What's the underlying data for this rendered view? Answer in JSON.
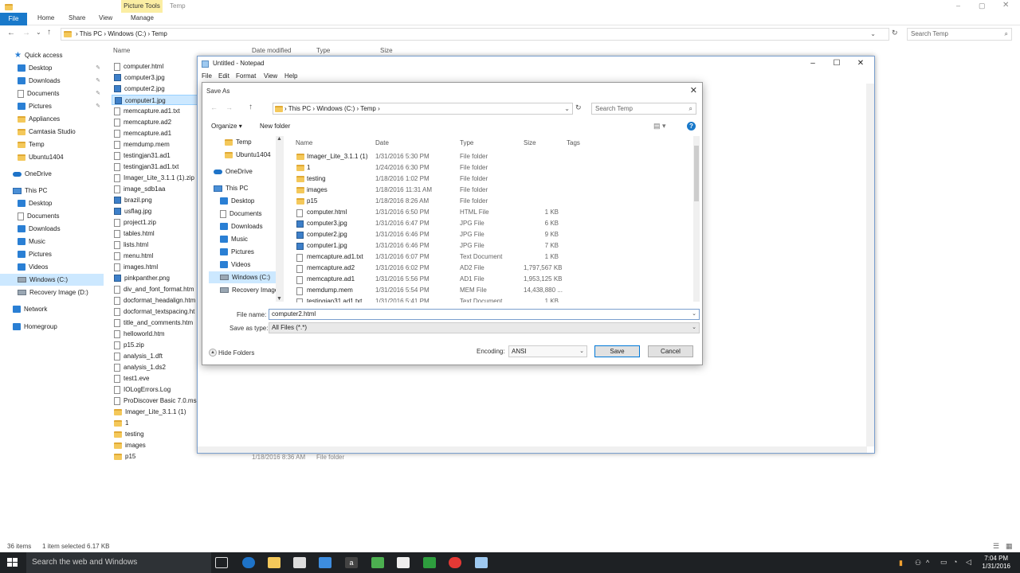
{
  "explorer": {
    "context_tab": "Picture Tools",
    "window_title": "Temp",
    "tabs": [
      "File",
      "Home",
      "Share",
      "View",
      "Manage"
    ],
    "breadcrumb": [
      "This PC",
      "Windows (C:)",
      "Temp"
    ],
    "search_placeholder": "Search Temp",
    "columns": [
      "Name",
      "Date modified",
      "Type",
      "Size"
    ],
    "nav": [
      {
        "label": "Quick access",
        "icon": "star-icon"
      },
      {
        "label": "Desktop",
        "icon": "desktop-icon",
        "pinned": true
      },
      {
        "label": "Downloads",
        "icon": "downloads-icon",
        "pinned": true
      },
      {
        "label": "Documents",
        "icon": "documents-icon",
        "pinned": true
      },
      {
        "label": "Pictures",
        "icon": "pictures-icon",
        "pinned": true
      },
      {
        "label": "Appliances",
        "icon": "folder-icon"
      },
      {
        "label": "Camtasia Studio",
        "icon": "folder-icon"
      },
      {
        "label": "Temp",
        "icon": "folder-icon"
      },
      {
        "label": "Ubuntu1404",
        "icon": "folder-icon"
      },
      {
        "label": "OneDrive",
        "icon": "onedrive-icon"
      },
      {
        "label": "This PC",
        "icon": "pc-icon"
      },
      {
        "label": "Desktop",
        "icon": "desktop-icon"
      },
      {
        "label": "Documents",
        "icon": "documents-icon"
      },
      {
        "label": "Downloads",
        "icon": "downloads-icon"
      },
      {
        "label": "Music",
        "icon": "music-icon"
      },
      {
        "label": "Pictures",
        "icon": "pictures-icon"
      },
      {
        "label": "Videos",
        "icon": "videos-icon"
      },
      {
        "label": "Windows (C:)",
        "icon": "drive-icon",
        "selected": true
      },
      {
        "label": "Recovery Image (D:)",
        "icon": "drive-icon"
      },
      {
        "label": "Network",
        "icon": "network-icon"
      },
      {
        "label": "Homegroup",
        "icon": "homegroup-icon"
      }
    ],
    "files": [
      {
        "name": "computer.html",
        "icon": "file"
      },
      {
        "name": "computer3.jpg",
        "icon": "img"
      },
      {
        "name": "computer2.jpg",
        "icon": "img"
      },
      {
        "name": "computer1.jpg",
        "icon": "img",
        "selected": true
      },
      {
        "name": "memcapture.ad1.txt",
        "icon": "file"
      },
      {
        "name": "memcapture.ad2",
        "icon": "file"
      },
      {
        "name": "memcapture.ad1",
        "icon": "file"
      },
      {
        "name": "memdump.mem",
        "icon": "file"
      },
      {
        "name": "testingjan31.ad1",
        "icon": "file"
      },
      {
        "name": "testingjan31.ad1.txt",
        "icon": "file"
      },
      {
        "name": "Imager_Lite_3.1.1 (1).zip",
        "icon": "file"
      },
      {
        "name": "image_sdb1aa",
        "icon": "file"
      },
      {
        "name": "brazil.png",
        "icon": "img"
      },
      {
        "name": "usflag.jpg",
        "icon": "img"
      },
      {
        "name": "project1.zip",
        "icon": "file"
      },
      {
        "name": "tables.html",
        "icon": "file"
      },
      {
        "name": "lists.html",
        "icon": "file"
      },
      {
        "name": "menu.html",
        "icon": "file"
      },
      {
        "name": "images.html",
        "icon": "file"
      },
      {
        "name": "pinkpanther.png",
        "icon": "img"
      },
      {
        "name": "div_and_font_format.htm",
        "icon": "file"
      },
      {
        "name": "docformat_headalign.htm",
        "icon": "file"
      },
      {
        "name": "docformat_textspacing.ht",
        "icon": "file"
      },
      {
        "name": "title_and_comments.htm",
        "icon": "file"
      },
      {
        "name": "helloworld.htm",
        "icon": "file"
      },
      {
        "name": "p15.zip",
        "icon": "file"
      },
      {
        "name": "analysis_1.dft",
        "icon": "file"
      },
      {
        "name": "analysis_1.ds2",
        "icon": "file"
      },
      {
        "name": "test1.eve",
        "icon": "file"
      },
      {
        "name": "IOLogErrors.Log",
        "icon": "file"
      },
      {
        "name": "ProDiscover Basic 7.0.msi",
        "icon": "file"
      },
      {
        "name": "Imager_Lite_3.1.1 (1)",
        "icon": "folder"
      },
      {
        "name": "1",
        "icon": "folder"
      },
      {
        "name": "testing",
        "icon": "folder"
      },
      {
        "name": "images",
        "icon": "folder"
      },
      {
        "name": "p15",
        "icon": "folder"
      }
    ],
    "bg_row_date": "1/18/2016 8:36 AM",
    "bg_row_type": "File folder",
    "status_items": "36 items",
    "status_selected": "1 item selected  6.17 KB"
  },
  "notepad": {
    "title": "Untitled - Notepad",
    "menu": [
      "File",
      "Edit",
      "Format",
      "View",
      "Help"
    ]
  },
  "saveas": {
    "title": "Save As",
    "breadcrumb": [
      "This PC",
      "Windows (C:)",
      "Temp"
    ],
    "search_placeholder": "Search Temp",
    "organize": "Organize",
    "new_folder": "New folder",
    "nav": [
      {
        "label": "Temp",
        "icon": "folder"
      },
      {
        "label": "Ubuntu1404",
        "icon": "folder"
      },
      {
        "label": "OneDrive",
        "icon": "cloud"
      },
      {
        "label": "This PC",
        "icon": "pc"
      },
      {
        "label": "Desktop",
        "icon": "blue"
      },
      {
        "label": "Documents",
        "icon": "file"
      },
      {
        "label": "Downloads",
        "icon": "blue"
      },
      {
        "label": "Music",
        "icon": "music"
      },
      {
        "label": "Pictures",
        "icon": "blue"
      },
      {
        "label": "Videos",
        "icon": "blue"
      },
      {
        "label": "Windows (C:)",
        "icon": "drive",
        "selected": true
      },
      {
        "label": "Recovery Image",
        "icon": "drive"
      }
    ],
    "columns": [
      "Name",
      "Date",
      "Type",
      "Size",
      "Tags"
    ],
    "rows": [
      {
        "name": "Imager_Lite_3.1.1 (1)",
        "date": "1/31/2016 5:30 PM",
        "type": "File folder",
        "size": "",
        "icon": "folder"
      },
      {
        "name": "1",
        "date": "1/24/2016 6:30 PM",
        "type": "File folder",
        "size": "",
        "icon": "folder"
      },
      {
        "name": "testing",
        "date": "1/18/2016 1:02 PM",
        "type": "File folder",
        "size": "",
        "icon": "folder"
      },
      {
        "name": "images",
        "date": "1/18/2016 11:31 AM",
        "type": "File folder",
        "size": "",
        "icon": "folder"
      },
      {
        "name": "p15",
        "date": "1/18/2016 8:26 AM",
        "type": "File folder",
        "size": "",
        "icon": "folder"
      },
      {
        "name": "computer.html",
        "date": "1/31/2016 6:50 PM",
        "type": "HTML File",
        "size": "1 KB",
        "icon": "file"
      },
      {
        "name": "computer3.jpg",
        "date": "1/31/2016 6:47 PM",
        "type": "JPG File",
        "size": "6 KB",
        "icon": "img"
      },
      {
        "name": "computer2.jpg",
        "date": "1/31/2016 6:46 PM",
        "type": "JPG File",
        "size": "9 KB",
        "icon": "img"
      },
      {
        "name": "computer1.jpg",
        "date": "1/31/2016 6:46 PM",
        "type": "JPG File",
        "size": "7 KB",
        "icon": "img"
      },
      {
        "name": "memcapture.ad1.txt",
        "date": "1/31/2016 6:07 PM",
        "type": "Text Document",
        "size": "1 KB",
        "icon": "file"
      },
      {
        "name": "memcapture.ad2",
        "date": "1/31/2016 6:02 PM",
        "type": "AD2 File",
        "size": "1,797,567 KB",
        "icon": "file"
      },
      {
        "name": "memcapture.ad1",
        "date": "1/31/2016 5:56 PM",
        "type": "AD1 File",
        "size": "1,953,125 KB",
        "icon": "file"
      },
      {
        "name": "memdump.mem",
        "date": "1/31/2016 5:54 PM",
        "type": "MEM File",
        "size": "14,438,880 ...",
        "icon": "file"
      },
      {
        "name": "testingjan31.ad1.txt",
        "date": "1/31/2016 5:41 PM",
        "type": "Text Document",
        "size": "1 KB",
        "icon": "file"
      }
    ],
    "file_name_label": "File name:",
    "file_name_value": "computer2.html",
    "save_type_label": "Save as type:",
    "save_type_value": "All Files  (*.*)",
    "hide_folders": "Hide Folders",
    "encoding_label": "Encoding:",
    "encoding_value": "ANSI",
    "save_button": "Save",
    "cancel_button": "Cancel"
  },
  "taskbar": {
    "search_placeholder": "Search the web and Windows",
    "time": "7:04 PM",
    "date": "1/31/2016"
  },
  "colors": {
    "accent": "#1979ca",
    "selection": "#cce8ff",
    "taskbar": "#1e2124"
  }
}
